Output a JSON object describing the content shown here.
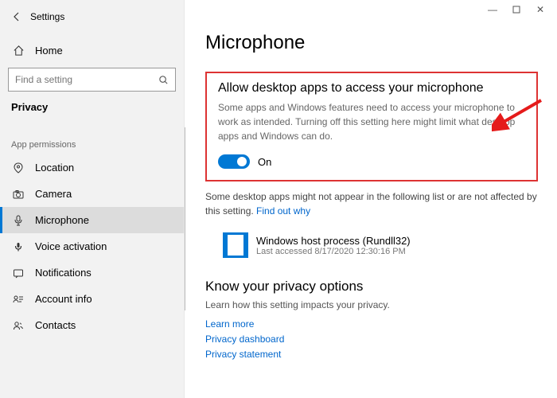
{
  "window": {
    "title": "Settings"
  },
  "sidebar": {
    "home": "Home",
    "search_placeholder": "Find a setting",
    "section": "Privacy",
    "group": "App permissions",
    "items": [
      {
        "label": "Location"
      },
      {
        "label": "Camera"
      },
      {
        "label": "Microphone"
      },
      {
        "label": "Voice activation"
      },
      {
        "label": "Notifications"
      },
      {
        "label": "Account info"
      },
      {
        "label": "Contacts"
      }
    ]
  },
  "main": {
    "title": "Microphone",
    "setting_title": "Allow desktop apps to access your microphone",
    "setting_desc": "Some apps and Windows features need to access your microphone to work as intended. Turning off this setting here might limit what desktop apps and Windows can do.",
    "toggle_state": "On",
    "note_before": "Some desktop apps might not appear in the following list or are not affected by this setting. ",
    "note_link": "Find out why",
    "app": {
      "name": "Windows host process (Rundll32)",
      "meta": "Last accessed 8/17/2020 12:30:16 PM"
    },
    "privacy": {
      "title": "Know your privacy options",
      "desc": "Learn how this setting impacts your privacy.",
      "links": [
        "Learn more",
        "Privacy dashboard",
        "Privacy statement"
      ]
    }
  }
}
